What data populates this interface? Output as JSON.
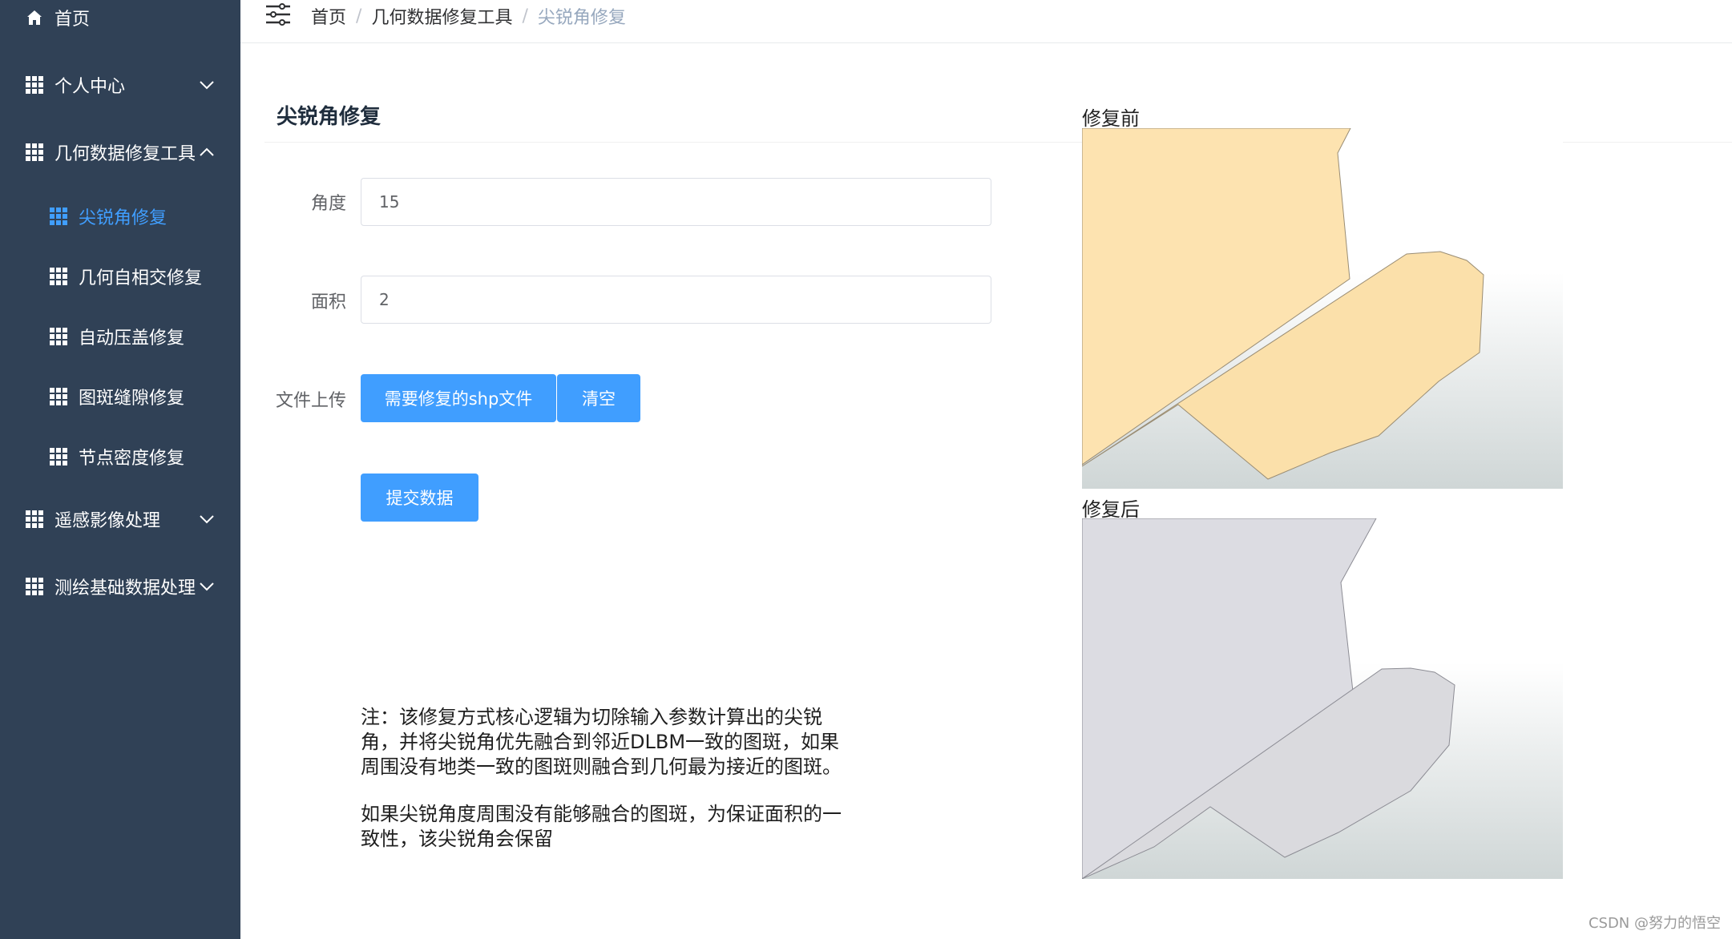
{
  "sidebar": {
    "items": [
      {
        "label": "首页",
        "icon": "home-icon"
      },
      {
        "label": "个人中心",
        "icon": "grid-icon",
        "expanded": false
      },
      {
        "label": "几何数据修复工具",
        "icon": "grid-icon",
        "expanded": true
      },
      {
        "label": "尖锐角修复",
        "icon": "grid-icon",
        "active": true
      },
      {
        "label": "几何自相交修复",
        "icon": "grid-icon"
      },
      {
        "label": "自动压盖修复",
        "icon": "grid-icon"
      },
      {
        "label": "图斑缝隙修复",
        "icon": "grid-icon"
      },
      {
        "label": "节点密度修复",
        "icon": "grid-icon"
      },
      {
        "label": "遥感影像处理",
        "icon": "grid-icon",
        "expanded": false
      },
      {
        "label": "测绘基础数据处理",
        "icon": "grid-icon",
        "expanded": false
      }
    ],
    "colors": {
      "background": "#304156",
      "text": "#ffffff",
      "active": "#409eff"
    }
  },
  "header": {
    "breadcrumb": [
      "首页",
      "几何数据修复工具",
      "尖锐角修复"
    ],
    "separator": "/"
  },
  "main": {
    "title": "尖锐角修复",
    "form": {
      "angle_label": "角度",
      "angle_value": "15",
      "area_label": "面积",
      "area_value": "2",
      "upload_label": "文件上传",
      "upload_button": "需要修复的shp文件",
      "clear_button": "清空",
      "submit_button": "提交数据"
    },
    "note": {
      "para1": "注：该修复方式核心逻辑为切除输入参数计算出的尖锐角，并将尖锐角优先融合到邻近DLBM一致的图斑，如果周围没有地类一致的图斑则融合到几何最为接近的图斑。",
      "para2": "如果尖锐角度周围没有能够融合的图斑，为保证面积的一致性，该尖锐角会保留"
    },
    "images": {
      "before_label": "修复前",
      "after_label": "修复后",
      "before_fill": "#fde3b0",
      "after_fill": "#dcdce2"
    }
  },
  "watermark": "CSDN @努力的悟空",
  "accent": "#409eff"
}
